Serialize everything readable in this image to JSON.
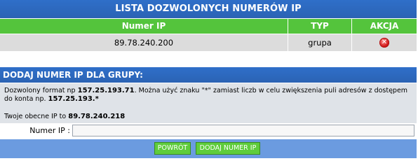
{
  "header": {
    "title": "LISTA DOZWOLONYCH NUMERÓW IP"
  },
  "table": {
    "columns": [
      "Numer IP",
      "TYP",
      "AKCJA"
    ],
    "rows": [
      {
        "ip": "89.78.240.200",
        "type": "grupa",
        "action_icon": "delete-icon"
      }
    ]
  },
  "add_section": {
    "title": "DODAJ NUMER IP DLA GRUPY:",
    "info_prefix": "Dozwolony format np ",
    "info_example1": "157.25.193.71",
    "info_middle": ". Można użyć znaku \"*\" zamiast liczb w celu zwiększenia puli adresów z dostępem do konta np. ",
    "info_example2": "157.25.193.*",
    "current_ip_label": "Twoje obecne IP to ",
    "current_ip": "89.78.240.218",
    "field_label": "Numer IP :",
    "field_value": "",
    "reset_label": "POWRÓT",
    "submit_label": "DODAJ NUMER IP"
  },
  "colors": {
    "header_blue": "#2f6fc9",
    "table_header_green": "#54c43c",
    "row_grey": "#dcdcdc",
    "button_green": "#5fcc3c",
    "button_bar_blue": "#6b9be0"
  }
}
